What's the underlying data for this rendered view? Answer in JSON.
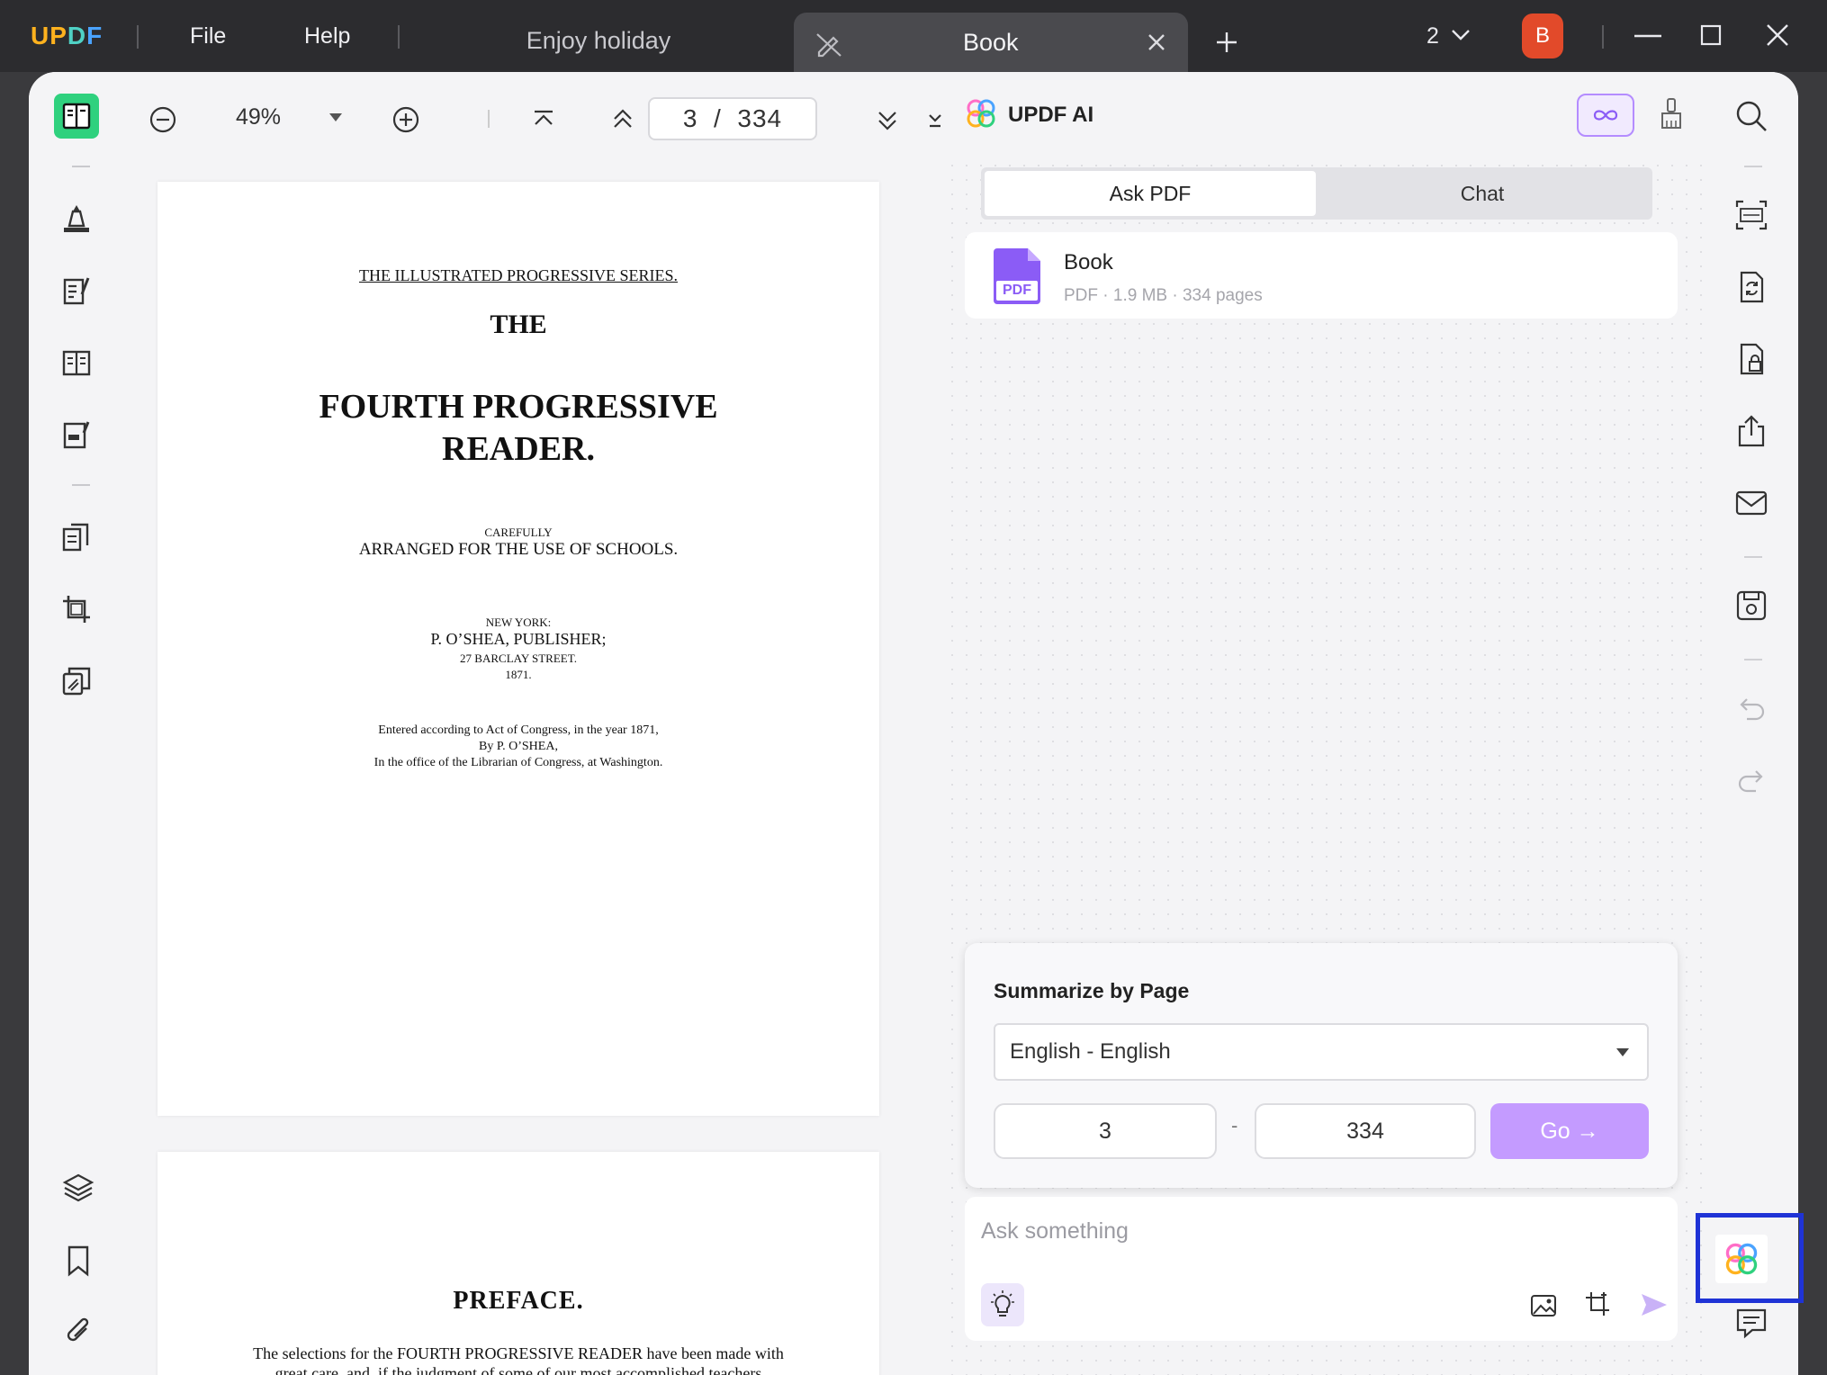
{
  "app": {
    "logo": "UPDF"
  },
  "menu": {
    "file": "File",
    "help": "Help"
  },
  "tabs": {
    "inactive": "Enjoy holiday",
    "active": "Book"
  },
  "window_controls": {
    "count": "2",
    "avatar": "B"
  },
  "toolbar": {
    "zoom": "49%",
    "current_page": "3",
    "page_separator": "/",
    "total_pages": "334"
  },
  "pdf": {
    "page1": {
      "series": "THE ILLUSTRATED PROGRESSIVE SERIES.",
      "the": "THE",
      "title1": "FOURTH PROGRESSIVE",
      "title2": "READER.",
      "carefully": "CAREFULLY",
      "arranged": "ARRANGED FOR THE USE OF SCHOOLS.",
      "city": "NEW YORK:",
      "publisher": "P. O’SHEA, PUBLISHER;",
      "street": "27 BARCLAY STREET.",
      "year": "1871.",
      "entered1": "Entered according to Act of Congress, in the year 1871,",
      "entered2": "By P. O’SHEA,",
      "entered3": "In the office of the Librarian of Congress, at Washington."
    },
    "page2": {
      "heading": "PREFACE.",
      "line1": "The selections for the FOURTH PROGRESSIVE READER have been made with",
      "line2": "great care, and, if the judgment of some of our most accomplished teachers"
    }
  },
  "ai": {
    "title": "UPDF AI",
    "tabs": {
      "ask_pdf": "Ask PDF",
      "chat": "Chat"
    },
    "file": {
      "name": "Book",
      "badge": "PDF",
      "meta": "PDF · 1.9 MB · 334 pages"
    },
    "summarize": {
      "title": "Summarize by Page",
      "language": "English - English",
      "from": "3",
      "dash": "-",
      "to": "334",
      "go": "Go →"
    },
    "ask": {
      "placeholder": "Ask something"
    }
  },
  "colors": {
    "accent_green": "#2fd17e",
    "accent_purple": "#c49bff",
    "avatar_red": "#e24a2a",
    "highlight_blue": "#1f33d6"
  }
}
